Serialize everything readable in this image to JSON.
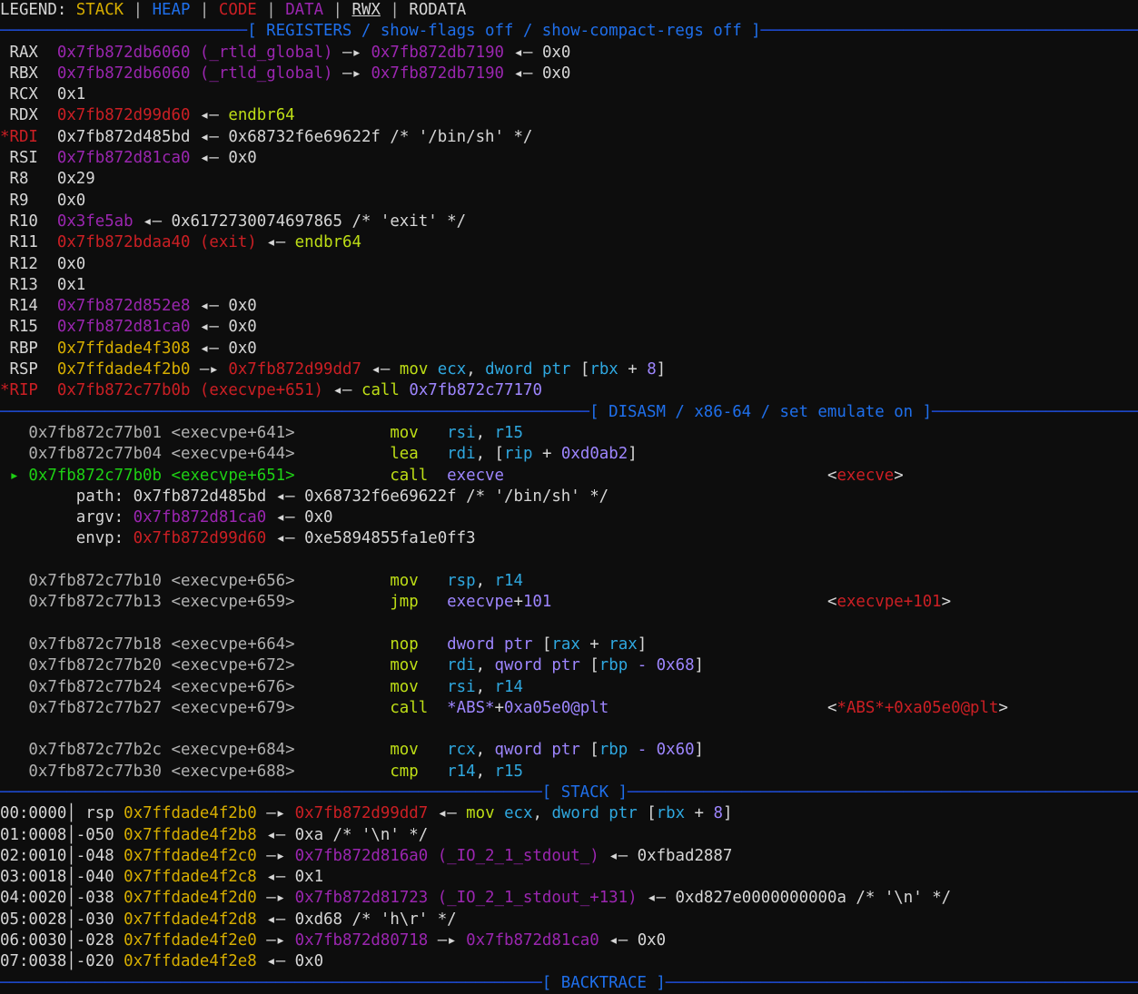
{
  "legend": {
    "label": "LEGEND:",
    "items": [
      {
        "name": "STACK",
        "color": "#d7ae00"
      },
      {
        "name": "HEAP",
        "color": "#1f6feb"
      },
      {
        "name": "CODE",
        "color": "#cc1f24"
      },
      {
        "name": "DATA",
        "color": "#9b26b0"
      },
      {
        "name": "RWX",
        "color": "#d6d6d6"
      },
      {
        "name": "RODATA",
        "color": "#d6d6d6"
      }
    ],
    "separator": "|"
  },
  "banners": {
    "registers": "[ REGISTERS / show-flags off / show-compact-regs off ]",
    "disasm": "[ DISASM / x86-64 / set emulate on ]",
    "stack": "[ STACK ]",
    "backtrace": "[ BACKTRACE ]"
  },
  "registers": [
    {
      "marked": false,
      "name": "RAX",
      "value": "0x7fb872db6060",
      "symbol": "(_rtld_global)",
      "value_color": "data",
      "chain": [
        {
          "arrow": "->",
          "text": "0x7fb872db7190",
          "color": "data"
        },
        {
          "arrow": "<-",
          "text": "0x0",
          "color": "white"
        }
      ]
    },
    {
      "marked": false,
      "name": "RBX",
      "value": "0x7fb872db6060",
      "symbol": "(_rtld_global)",
      "value_color": "data",
      "chain": [
        {
          "arrow": "->",
          "text": "0x7fb872db7190",
          "color": "data"
        },
        {
          "arrow": "<-",
          "text": "0x0",
          "color": "white"
        }
      ]
    },
    {
      "marked": false,
      "name": "RCX",
      "value": "0x1",
      "symbol": "",
      "value_color": "white",
      "chain": []
    },
    {
      "marked": false,
      "name": "RDX",
      "value": "0x7fb872d99d60",
      "symbol": "",
      "value_color": "code",
      "chain": [
        {
          "arrow": "<-",
          "text": "endbr64",
          "color": "mnem"
        }
      ]
    },
    {
      "marked": true,
      "name": "RDI",
      "value": "0x7fb872d485bd",
      "symbol": "",
      "value_color": "white",
      "chain": [
        {
          "arrow": "<-",
          "text": "0x68732f6e69622f /* '/bin/sh' */",
          "color": "white"
        }
      ]
    },
    {
      "marked": false,
      "name": "RSI",
      "value": "0x7fb872d81ca0",
      "symbol": "",
      "value_color": "data",
      "chain": [
        {
          "arrow": "<-",
          "text": "0x0",
          "color": "white"
        }
      ]
    },
    {
      "marked": false,
      "name": "R8",
      "value": "0x29",
      "symbol": "",
      "value_color": "white",
      "chain": []
    },
    {
      "marked": false,
      "name": "R9",
      "value": "0x0",
      "symbol": "",
      "value_color": "white",
      "chain": []
    },
    {
      "marked": false,
      "name": "R10",
      "value": "0x3fe5ab",
      "symbol": "",
      "value_color": "data",
      "chain": [
        {
          "arrow": "<-",
          "text": "0x6172730074697865 /* 'exit' */",
          "color": "white"
        }
      ]
    },
    {
      "marked": false,
      "name": "R11",
      "value": "0x7fb872bdaa40",
      "symbol": "(exit)",
      "value_color": "code",
      "chain": [
        {
          "arrow": "<-",
          "text": "endbr64",
          "color": "mnem"
        }
      ]
    },
    {
      "marked": false,
      "name": "R12",
      "value": "0x0",
      "symbol": "",
      "value_color": "white",
      "chain": []
    },
    {
      "marked": false,
      "name": "R13",
      "value": "0x1",
      "symbol": "",
      "value_color": "white",
      "chain": []
    },
    {
      "marked": false,
      "name": "R14",
      "value": "0x7fb872d852e8",
      "symbol": "",
      "value_color": "data",
      "chain": [
        {
          "arrow": "<-",
          "text": "0x0",
          "color": "white"
        }
      ]
    },
    {
      "marked": false,
      "name": "R15",
      "value": "0x7fb872d81ca0",
      "symbol": "",
      "value_color": "data",
      "chain": [
        {
          "arrow": "<-",
          "text": "0x0",
          "color": "white"
        }
      ]
    },
    {
      "marked": false,
      "name": "RBP",
      "value": "0x7ffdade4f308",
      "symbol": "",
      "value_color": "stack",
      "chain": [
        {
          "arrow": "<-",
          "text": "0x0",
          "color": "white"
        }
      ]
    },
    {
      "marked": false,
      "name": "RSP",
      "value": "0x7ffdade4f2b0",
      "symbol": "",
      "value_color": "stack",
      "chain": [
        {
          "arrow": "->",
          "text": "0x7fb872d99dd7",
          "color": "code"
        },
        {
          "arrow": "<-",
          "text": "ASM:mov ecx, dword ptr [rbx + 8]",
          "color": "asm"
        }
      ]
    },
    {
      "marked": true,
      "name": "RIP",
      "value": "0x7fb872c77b0b",
      "symbol": "(execvpe+651)",
      "value_color": "code",
      "chain": [
        {
          "arrow": "<-",
          "text": "CALL:call 0x7fb872c77170",
          "color": "asm"
        }
      ]
    }
  ],
  "disasm": [
    {
      "kind": "insn",
      "current": false,
      "addr": "0x7fb872c77b01",
      "sym": "<execvpe+641>",
      "mnem": "mov",
      "ops": "rsi, r15",
      "ann": ""
    },
    {
      "kind": "insn",
      "current": false,
      "addr": "0x7fb872c77b04",
      "sym": "<execvpe+644>",
      "mnem": "lea",
      "ops": "rdi, [rip + 0xd0ab2]",
      "ann": ""
    },
    {
      "kind": "insn",
      "current": true,
      "addr": "0x7fb872c77b0b",
      "sym": "<execvpe+651>",
      "mnem": "call",
      "ops": "execve",
      "ann": "<execve>"
    },
    {
      "kind": "arg",
      "label": "path:",
      "value": "0x7fb872d485bd",
      "value_color": "white",
      "rest": "<- 0x68732f6e69622f /* '/bin/sh' */"
    },
    {
      "kind": "arg",
      "label": "argv:",
      "value": "0x7fb872d81ca0",
      "value_color": "data",
      "rest": "<- 0x0"
    },
    {
      "kind": "arg",
      "label": "envp:",
      "value": "0x7fb872d99d60",
      "value_color": "code",
      "rest": "<- 0xe5894855fa1e0ff3"
    },
    {
      "kind": "blank"
    },
    {
      "kind": "insn",
      "current": false,
      "addr": "0x7fb872c77b10",
      "sym": "<execvpe+656>",
      "mnem": "mov",
      "ops": "rsp, r14",
      "ann": ""
    },
    {
      "kind": "insn",
      "current": false,
      "addr": "0x7fb872c77b13",
      "sym": "<execvpe+659>",
      "mnem": "jmp",
      "ops": "execvpe+101",
      "ann": "<execvpe+101>"
    },
    {
      "kind": "blank"
    },
    {
      "kind": "insn",
      "current": false,
      "addr": "0x7fb872c77b18",
      "sym": "<execvpe+664>",
      "mnem": "nop",
      "ops": "dword ptr [rax + rax]",
      "ann": ""
    },
    {
      "kind": "insn",
      "current": false,
      "addr": "0x7fb872c77b20",
      "sym": "<execvpe+672>",
      "mnem": "mov",
      "ops": "rdi, qword ptr [rbp - 0x68]",
      "ann": ""
    },
    {
      "kind": "insn",
      "current": false,
      "addr": "0x7fb872c77b24",
      "sym": "<execvpe+676>",
      "mnem": "mov",
      "ops": "rsi, r14",
      "ann": ""
    },
    {
      "kind": "insn",
      "current": false,
      "addr": "0x7fb872c77b27",
      "sym": "<execvpe+679>",
      "mnem": "call",
      "ops": "*ABS*+0xa05e0@plt",
      "ann": "<*ABS*+0xa05e0@plt>"
    },
    {
      "kind": "blank"
    },
    {
      "kind": "insn",
      "current": false,
      "addr": "0x7fb872c77b2c",
      "sym": "<execvpe+684>",
      "mnem": "mov",
      "ops": "rcx, qword ptr [rbp - 0x60]",
      "ann": ""
    },
    {
      "kind": "insn",
      "current": false,
      "addr": "0x7fb872c77b30",
      "sym": "<execvpe+688>",
      "mnem": "cmp",
      "ops": "r14, r15",
      "ann": ""
    }
  ],
  "stack": [
    {
      "index": "00:0000",
      "offset": "rsp",
      "addr": "0x7ffdade4f2b0",
      "chain": [
        {
          "arrow": "->",
          "text": "0x7fb872d99dd7",
          "color": "code"
        },
        {
          "arrow": "<-",
          "text": "ASM:mov ecx, dword ptr [rbx + 8]",
          "color": "asm"
        }
      ]
    },
    {
      "index": "01:0008",
      "offset": "-050",
      "addr": "0x7ffdade4f2b8",
      "chain": [
        {
          "arrow": "<-",
          "text": "0xa /* '\\n' */",
          "color": "white"
        }
      ]
    },
    {
      "index": "02:0010",
      "offset": "-048",
      "addr": "0x7ffdade4f2c0",
      "chain": [
        {
          "arrow": "->",
          "text": "0x7fb872d816a0 (_IO_2_1_stdout_)",
          "color": "data"
        },
        {
          "arrow": "<-",
          "text": "0xfbad2887",
          "color": "white"
        }
      ]
    },
    {
      "index": "03:0018",
      "offset": "-040",
      "addr": "0x7ffdade4f2c8",
      "chain": [
        {
          "arrow": "<-",
          "text": "0x1",
          "color": "white"
        }
      ]
    },
    {
      "index": "04:0020",
      "offset": "-038",
      "addr": "0x7ffdade4f2d0",
      "chain": [
        {
          "arrow": "->",
          "text": "0x7fb872d81723 (_IO_2_1_stdout_+131)",
          "color": "data"
        },
        {
          "arrow": "<-",
          "text": "0xd827e0000000000a /* '\\n' */",
          "color": "white"
        }
      ]
    },
    {
      "index": "05:0028",
      "offset": "-030",
      "addr": "0x7ffdade4f2d8",
      "chain": [
        {
          "arrow": "<-",
          "text": "0xd68 /* 'h\\r' */",
          "color": "white"
        }
      ]
    },
    {
      "index": "06:0030",
      "offset": "-028",
      "addr": "0x7ffdade4f2e0",
      "chain": [
        {
          "arrow": "->",
          "text": "0x7fb872d80718",
          "color": "data"
        },
        {
          "arrow": "->",
          "text": "0x7fb872d81ca0",
          "color": "data"
        },
        {
          "arrow": "<-",
          "text": "0x0",
          "color": "white"
        }
      ]
    },
    {
      "index": "07:0038",
      "offset": "-020",
      "addr": "0x7ffdade4f2e8",
      "chain": [
        {
          "arrow": "<-",
          "text": "0x0",
          "color": "white"
        }
      ]
    }
  ],
  "asm_tokens": {
    "mov ecx, dword ptr [rbx + 8]": [
      {
        "t": "mov",
        "c": "mnem"
      },
      {
        "t": " ",
        "c": "white"
      },
      {
        "t": "ecx",
        "c": "reg"
      },
      {
        "t": ", ",
        "c": "white"
      },
      {
        "t": "dword ptr ",
        "c": "reg"
      },
      {
        "t": "[",
        "c": "white"
      },
      {
        "t": "rbx",
        "c": "reg"
      },
      {
        "t": " + ",
        "c": "white"
      },
      {
        "t": "8",
        "c": "const"
      },
      {
        "t": "]",
        "c": "white"
      }
    ],
    "call 0x7fb872c77170": [
      {
        "t": "call",
        "c": "mnem"
      },
      {
        "t": " ",
        "c": "white"
      },
      {
        "t": "0x7fb872c77170",
        "c": "const"
      }
    ]
  },
  "marker": {
    "current_insn": "▸",
    "reg_star": "*"
  }
}
